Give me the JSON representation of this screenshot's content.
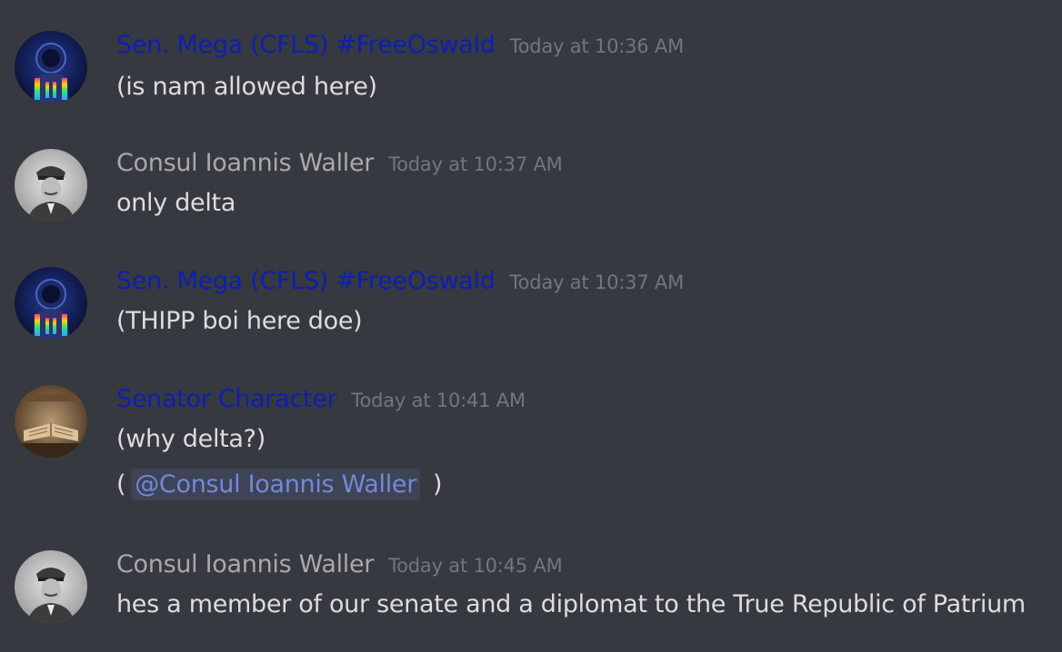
{
  "colors": {
    "background": "#36393f",
    "blue_role": "#0c1fb4",
    "gray_name": "#a7a9ac",
    "text": "#dcddde",
    "timestamp": "#72767d",
    "mention": "#7289da"
  },
  "messages": [
    {
      "author": "Sen. Mega (CFLS) #FreeOswald",
      "author_color": "#0c1fb4",
      "avatar": "astronaut-avatar",
      "timestamp": "Today at 10:36 AM",
      "lines": [
        "(is nam allowed here)"
      ]
    },
    {
      "author": "Consul Ioannis Waller",
      "author_color": "#a7a9ac",
      "avatar": "officer-avatar",
      "timestamp": "Today at 10:37 AM",
      "lines": [
        "only delta"
      ]
    },
    {
      "author": "Sen. Mega (CFLS) #FreeOswald",
      "author_color": "#0c1fb4",
      "avatar": "astronaut-avatar",
      "timestamp": "Today at 10:37 AM",
      "lines": [
        "(THIPP boi here doe)"
      ]
    },
    {
      "author": "Senator Character",
      "author_color": "#0c1fb4",
      "avatar": "books-avatar",
      "timestamp": "Today at 10:41 AM",
      "lines": [
        "(why delta?)"
      ],
      "mention_line": {
        "open": "(",
        "mention": "@Consul Ioannis Waller",
        "close": ")"
      }
    },
    {
      "author": "Consul Ioannis Waller",
      "author_color": "#a7a9ac",
      "avatar": "officer-avatar",
      "timestamp": "Today at 10:45 AM",
      "lines": [
        "hes a member of our senate and a diplomat to the True Republic of Patrium"
      ]
    }
  ]
}
